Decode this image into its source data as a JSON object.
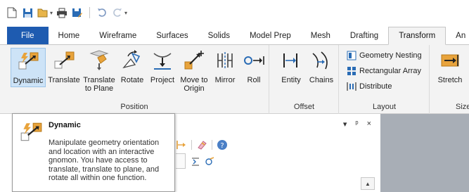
{
  "quick_access": {
    "icons": [
      "new-file-icon",
      "save-icon",
      "open-icon",
      "print-icon",
      "save-as-icon",
      "undo-icon",
      "redo-icon",
      "customize-icon"
    ]
  },
  "tabs": [
    {
      "label": "File",
      "active": false
    },
    {
      "label": "Home",
      "active": false
    },
    {
      "label": "Wireframe",
      "active": false
    },
    {
      "label": "Surfaces",
      "active": false
    },
    {
      "label": "Solids",
      "active": false
    },
    {
      "label": "Model Prep",
      "active": false
    },
    {
      "label": "Mesh",
      "active": false
    },
    {
      "label": "Drafting",
      "active": false
    },
    {
      "label": "Transform",
      "active": true
    },
    {
      "label": "An",
      "active": false
    }
  ],
  "ribbon": {
    "position_group": {
      "label": "Position",
      "buttons": [
        {
          "label": "Dynamic",
          "selected": true
        },
        {
          "label": "Translate"
        },
        {
          "label": "Translate to Plane"
        },
        {
          "label": "Rotate"
        },
        {
          "label": "Project"
        },
        {
          "label": "Move to Origin"
        },
        {
          "label": "Mirror"
        },
        {
          "label": "Roll"
        }
      ]
    },
    "offset_group": {
      "label": "Offset",
      "buttons": [
        {
          "label": "Entity"
        },
        {
          "label": "Chains"
        }
      ]
    },
    "layout_group": {
      "label": "Layout",
      "buttons": [
        {
          "label": "Geometry Nesting"
        },
        {
          "label": "Rectangular Array"
        },
        {
          "label": "Distribute"
        }
      ]
    },
    "size_group": {
      "label": "Size",
      "buttons": [
        {
          "label": "Stretch"
        }
      ]
    }
  },
  "panel": {
    "controls": [
      "▾",
      "ᵖ",
      "×"
    ]
  },
  "tooltip": {
    "title": "Dynamic",
    "description": "Manipulate geometry orientation and location with an interactive gnomon. You have access to translate, translate to plane, and rotate all within one function."
  },
  "colors": {
    "file_tab": "#1e5bb0",
    "ribbon_bg": "#f3f3f3",
    "accent_orange": "#e8a33b",
    "accent_blue": "#2a6cb5",
    "viewport": "#a8aeb6"
  }
}
